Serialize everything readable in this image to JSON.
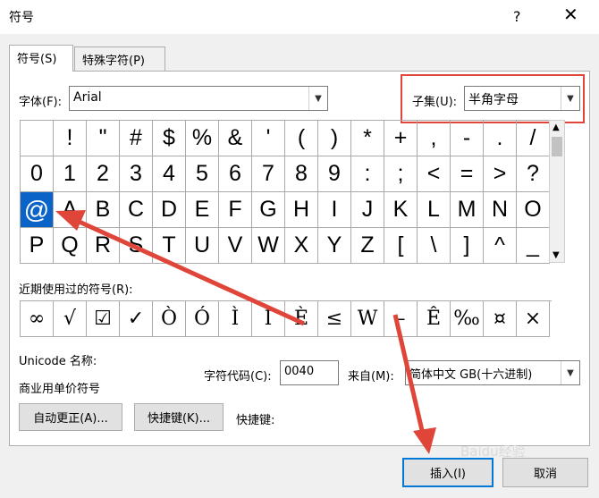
{
  "window": {
    "title": "符号",
    "help": "?",
    "close": "✕"
  },
  "tabs": [
    {
      "label": "符号(S)"
    },
    {
      "label": "特殊字符(P)"
    }
  ],
  "font": {
    "label": "字体(F):",
    "value": "Arial"
  },
  "subset": {
    "label": "子集(U):",
    "value": "半角字母"
  },
  "grid": {
    "rows": [
      [
        " ",
        "!",
        "\"",
        "#",
        "$",
        "%",
        "&",
        "'",
        "(",
        ")",
        "*",
        "+",
        ",",
        "-",
        ".",
        "/"
      ],
      [
        "0",
        "1",
        "2",
        "3",
        "4",
        "5",
        "6",
        "7",
        "8",
        "9",
        ":",
        ";",
        "<",
        "=",
        ">",
        "?"
      ],
      [
        "@",
        "A",
        "B",
        "C",
        "D",
        "E",
        "F",
        "G",
        "H",
        "I",
        "J",
        "K",
        "L",
        "M",
        "N",
        "O"
      ],
      [
        "P",
        "Q",
        "R",
        "S",
        "T",
        "U",
        "V",
        "W",
        "X",
        "Y",
        "Z",
        "[",
        "\\",
        "]",
        "^",
        "_"
      ]
    ],
    "selected": "@"
  },
  "recent": {
    "label": "近期使用过的符号(R):",
    "items": [
      "∞",
      "√",
      "☑",
      "✓",
      "Ò",
      "Ó",
      "Ì",
      "Í",
      "È",
      "≤",
      "W",
      "–",
      "Ê",
      "‰",
      "¤",
      "×"
    ]
  },
  "unicode_name": {
    "label": "Unicode 名称:",
    "value": "商业用单价符号"
  },
  "char_code": {
    "label": "字符代码(C):",
    "value": "0040"
  },
  "from": {
    "label": "来自(M):",
    "value": "简体中文 GB(十六进制)"
  },
  "buttons": {
    "autocorrect": "自动更正(A)...",
    "shortcut_key": "快捷键(K)...",
    "shortcut_label": "快捷键:",
    "insert": "插入(I)",
    "cancel": "取消"
  },
  "accent_colors": {
    "selection": "#0a64c8",
    "annotation": "#e0453a"
  }
}
